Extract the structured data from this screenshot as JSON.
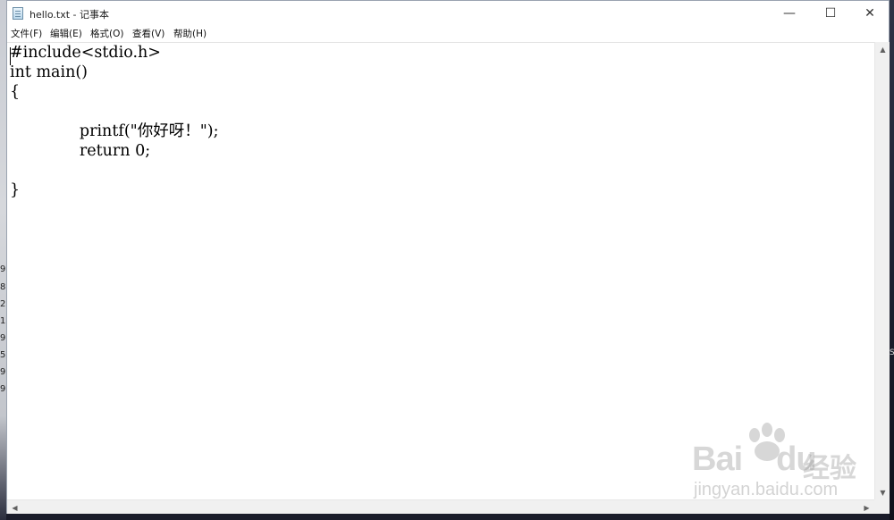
{
  "window": {
    "title": "hello.txt - 记事本",
    "controls": {
      "minimize": "—",
      "maximize": "☐",
      "close": "✕"
    }
  },
  "menu": [
    {
      "label": "文件(F)"
    },
    {
      "label": "编辑(E)"
    },
    {
      "label": "格式(O)"
    },
    {
      "label": "查看(V)"
    },
    {
      "label": "帮助(H)"
    }
  ],
  "editor": {
    "lines": [
      "#include<stdio.h>",
      "int main()",
      "{",
      "",
      "              printf(\"你好呀！\");",
      "              return 0;",
      "",
      "}"
    ]
  },
  "background": {
    "left_numbers": [
      "9",
      "8",
      "2",
      "1",
      "9",
      "5",
      "9",
      "9"
    ],
    "right_char": "S"
  },
  "watermark": {
    "brand": "Bai",
    "brand2": "du",
    "cn": "经验",
    "url": "jingyan.baidu.com"
  }
}
